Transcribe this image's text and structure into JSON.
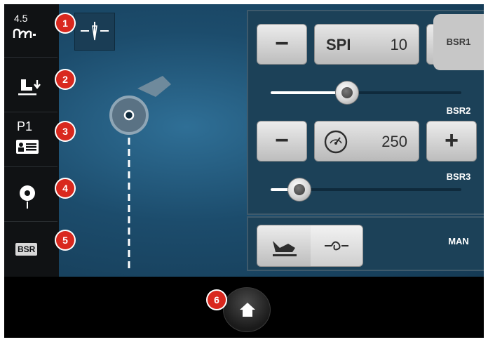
{
  "sidebar": {
    "stitch_length_value": "4.5",
    "program_label": "P1",
    "bsr_label": "BSR"
  },
  "badges": [
    "1",
    "2",
    "3",
    "4",
    "5",
    "6"
  ],
  "spi": {
    "minus_label": "−",
    "plus_label": "+",
    "label": "SPI",
    "value": "10",
    "slider_fraction": 0.4
  },
  "speed": {
    "minus_label": "−",
    "plus_label": "+",
    "value": "250",
    "slider_fraction": 0.15
  },
  "tabs": [
    "BSR1",
    "BSR2",
    "BSR3",
    "MAN"
  ],
  "colors": {
    "accent_blue": "#1c4c6c",
    "badge_red": "#d9281e"
  }
}
